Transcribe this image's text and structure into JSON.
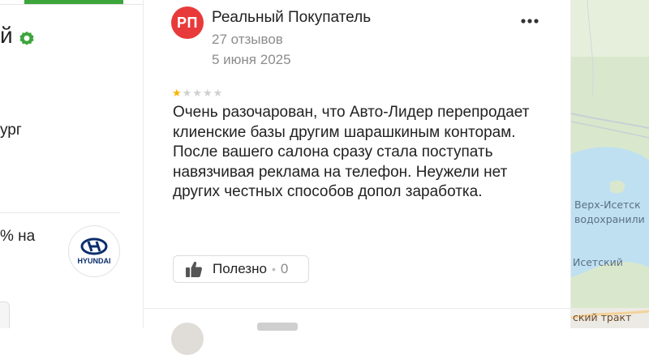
{
  "org_panel": {
    "title_fragment": "й",
    "city_fragment": "ург",
    "promo_fragment": "% на",
    "brand_logo": "HYUNDAI"
  },
  "review": {
    "avatar_initials": "РП",
    "author": "Реальный Покупатель",
    "reviews_count": "27 отзывов",
    "date": "5 июня 2025",
    "rating": 1,
    "rating_max": 5,
    "text": "Очень разочарован, что Авто-Лидер перепродает клиенские базы другим шарашкиным конторам. После вашего салона сразу стала поступать навязчивая реклама на телефон. Неужели нет других честных способов допол заработка.",
    "useful_label": "Полезно",
    "useful_count": "0"
  },
  "map": {
    "labels": [
      "Верх-Исетск",
      "водохранили",
      "Исетский",
      "ский тракт"
    ]
  },
  "colors": {
    "accent_green": "#3ca53c",
    "avatar_red": "#e83a3a",
    "star_active": "#fbb300",
    "star_inactive": "#d0d0d0",
    "map_water": "#bfe0f1",
    "map_land": "#d9e8cc"
  },
  "icons": {
    "verified": "verified-badge-icon",
    "more": "more-dots-icon",
    "useful": "thumbs-up-icon",
    "star": "star-icon"
  }
}
